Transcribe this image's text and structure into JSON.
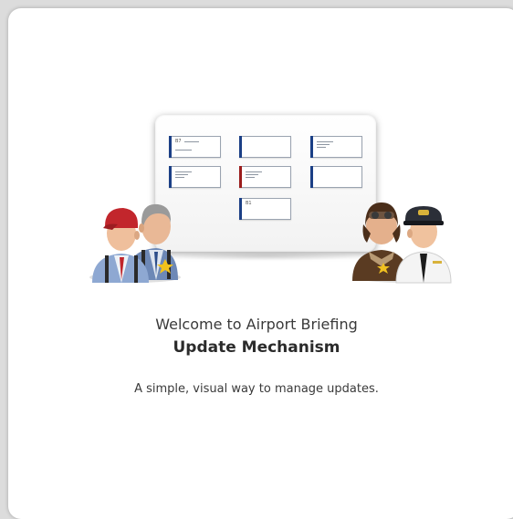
{
  "welcome": {
    "line1": "Welcome to Airport Briefing",
    "line2": "Update Mechanism",
    "tagline": "A simple, visual way to manage updates."
  },
  "illustration": {
    "board_icon": "whiteboard-icon",
    "notes": [
      {
        "tag": "B7",
        "accent": "#1b3f86"
      },
      {
        "tag": "",
        "accent": "#1b3f86"
      },
      {
        "tag": "",
        "accent": "#1b3f86"
      },
      {
        "tag": "",
        "accent": "#1b3f86"
      },
      {
        "tag": "",
        "accent": "#9b1c1c"
      },
      {
        "tag": "",
        "accent": "#1b3f86"
      },
      {
        "tag": "B1",
        "accent": "#1b3f86"
      }
    ],
    "left_group_icon": "ground-staff-icon",
    "right_group_icon": "pilots-icon"
  },
  "colors": {
    "note_blue": "#1b3f86",
    "note_red": "#9b1c1c",
    "card_bg": "#ffffff",
    "page_bg": "#dcdcdc"
  }
}
